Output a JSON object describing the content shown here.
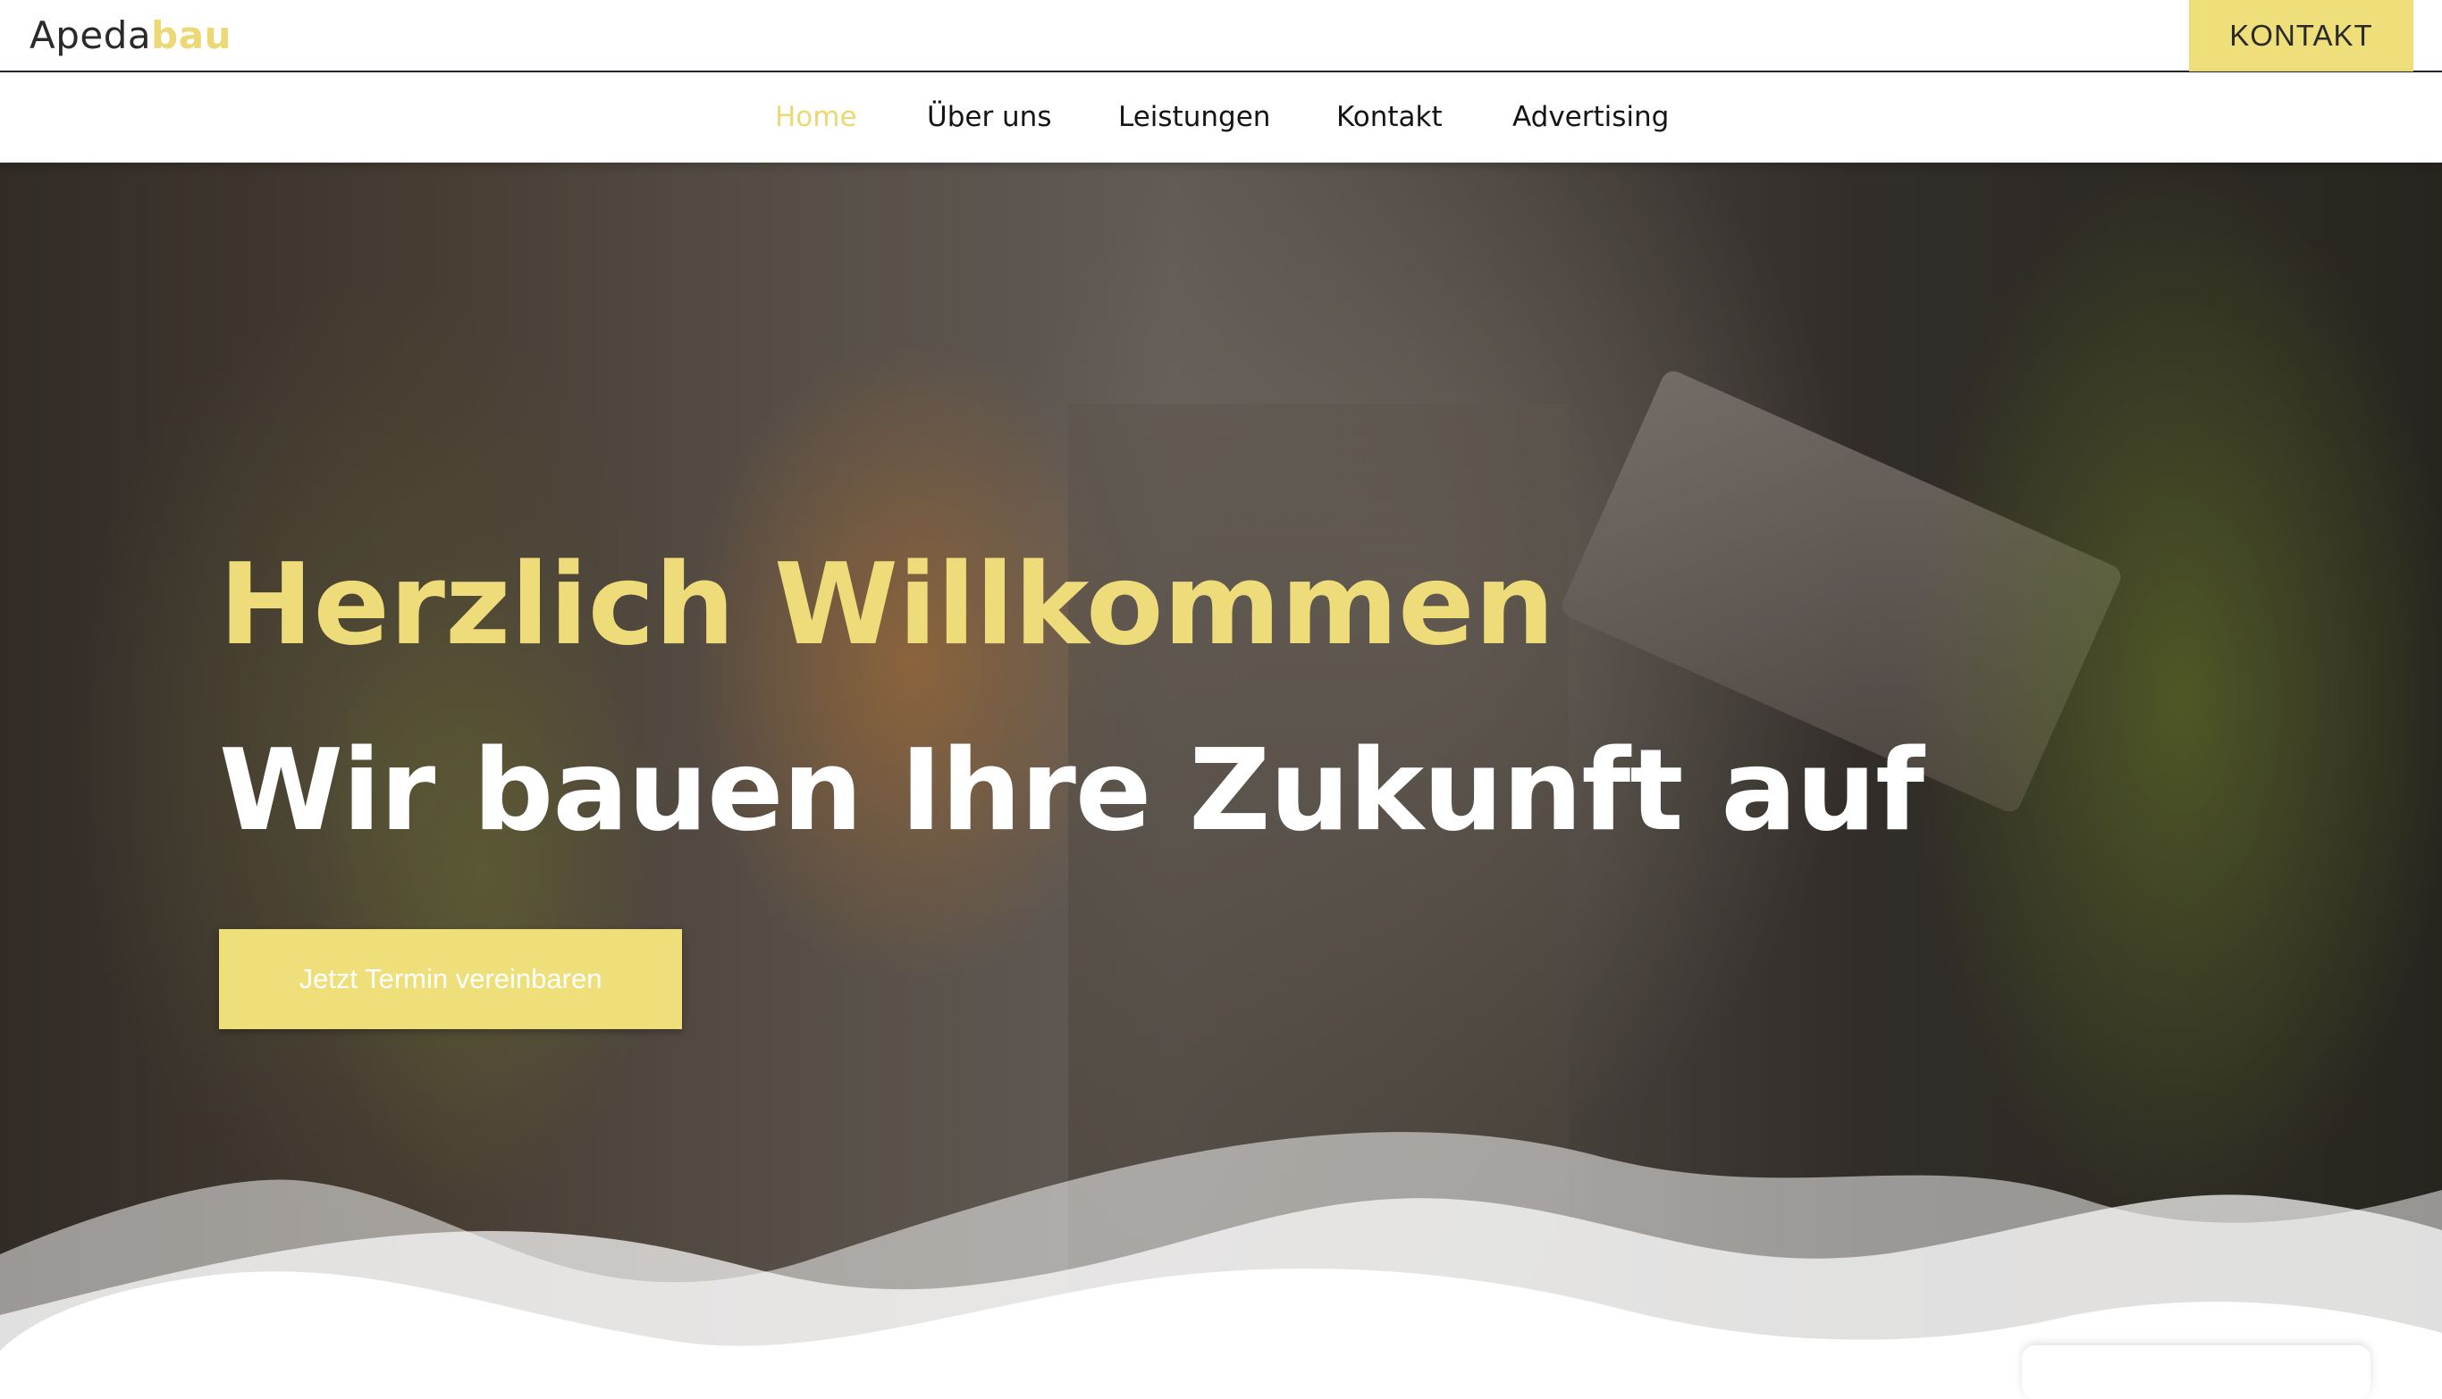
{
  "header": {
    "logo_main": "Apeda",
    "logo_accent": "bau",
    "contact_button": "KONTAKT"
  },
  "nav": {
    "items": [
      {
        "label": "Home",
        "active": true
      },
      {
        "label": "Über uns",
        "active": false
      },
      {
        "label": "Leistungen",
        "active": false
      },
      {
        "label": "Kontakt",
        "active": false
      },
      {
        "label": "Advertising",
        "active": false
      }
    ]
  },
  "hero": {
    "title_line1": "Herzlich Willkommen",
    "title_line2": "Wir bauen Ihre Zukunft auf",
    "cta_label": "Jetzt Termin vereinbaren"
  },
  "colors": {
    "accent": "#EEDC7A",
    "button": "#EFDF7B",
    "text_dark": "#151515",
    "header_border": "#1D2733"
  }
}
